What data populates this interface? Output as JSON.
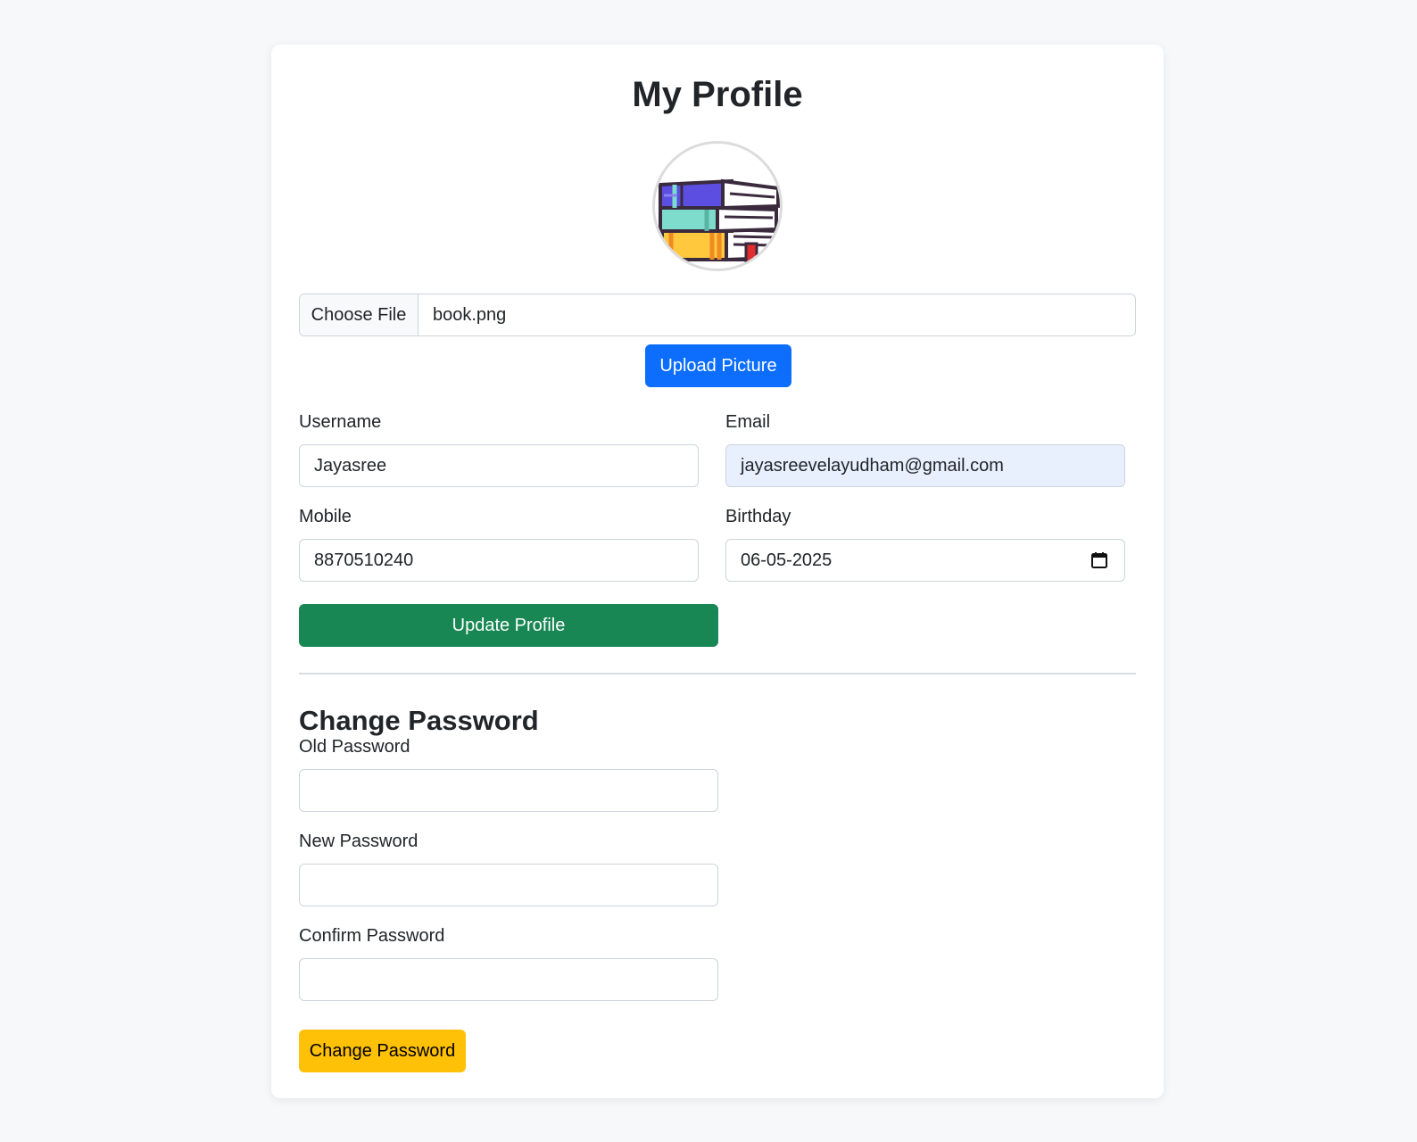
{
  "page": {
    "title": "My Profile"
  },
  "avatar": {
    "icon": "book-stack-icon"
  },
  "file_upload": {
    "choose_label": "Choose File",
    "file_name": "book.png",
    "upload_button": "Upload Picture"
  },
  "profile_form": {
    "username_label": "Username",
    "username_value": "Jayasree",
    "email_label": "Email",
    "email_value": "jayasreevelayudham@gmail.com",
    "mobile_label": "Mobile",
    "mobile_value": "8870510240",
    "birthday_label": "Birthday",
    "birthday_value": "06-05-2025",
    "update_button": "Update Profile"
  },
  "password_form": {
    "section_title": "Change Password",
    "old_label": "Old Password",
    "old_value": "",
    "new_label": "New Password",
    "new_value": "",
    "confirm_label": "Confirm Password",
    "confirm_value": "",
    "change_button": "Change Password"
  },
  "colors": {
    "page_bg": "#f7f8fa",
    "upload_button": "#0d6efd",
    "update_button": "#198754",
    "change_button": "#ffc107",
    "email_autofill_bg": "#e8f0fe"
  }
}
